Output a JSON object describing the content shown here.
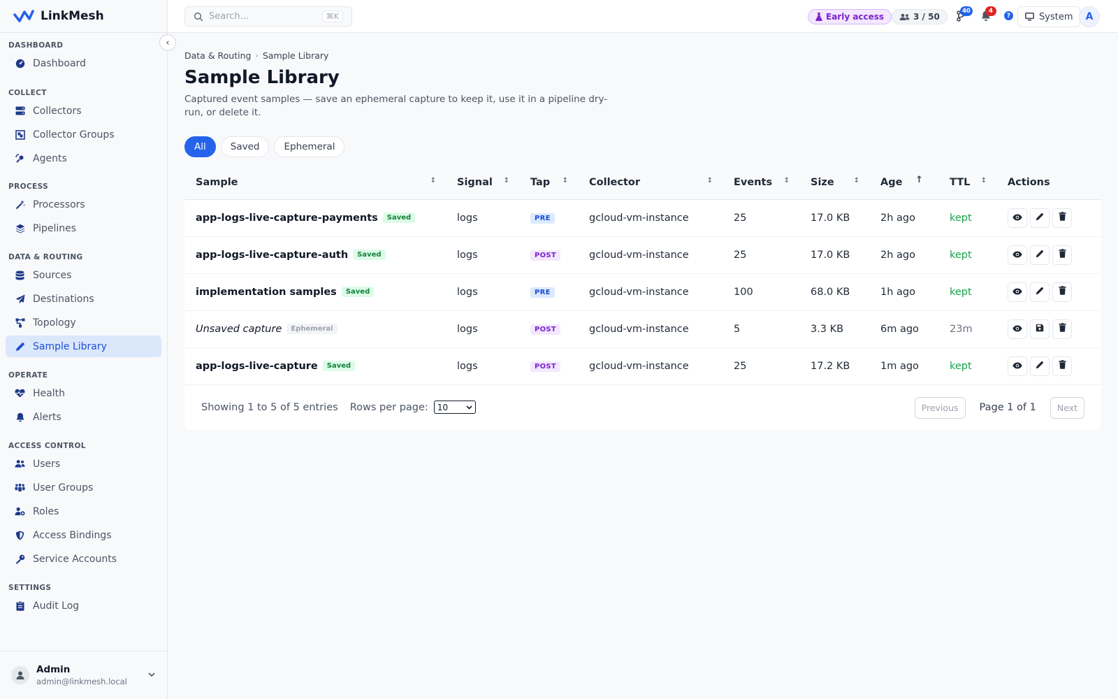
{
  "app": {
    "name": "LinkMesh"
  },
  "sidebar": {
    "sections": [
      {
        "title": "DASHBOARD",
        "items": [
          {
            "label": "Dashboard",
            "icon": "gauge-icon"
          }
        ]
      },
      {
        "title": "COLLECT",
        "items": [
          {
            "label": "Collectors",
            "icon": "server-icon"
          },
          {
            "label": "Collector Groups",
            "icon": "object-group-icon"
          },
          {
            "label": "Agents",
            "icon": "satellite-icon"
          }
        ]
      },
      {
        "title": "PROCESS",
        "items": [
          {
            "label": "Processors",
            "icon": "wand-icon"
          },
          {
            "label": "Pipelines",
            "icon": "layers-icon"
          }
        ]
      },
      {
        "title": "DATA & ROUTING",
        "items": [
          {
            "label": "Sources",
            "icon": "database-icon"
          },
          {
            "label": "Destinations",
            "icon": "paper-plane-icon"
          },
          {
            "label": "Topology",
            "icon": "topology-icon"
          },
          {
            "label": "Sample Library",
            "icon": "pen-icon",
            "active": true
          }
        ]
      },
      {
        "title": "OPERATE",
        "items": [
          {
            "label": "Health",
            "icon": "heart-pulse-icon"
          },
          {
            "label": "Alerts",
            "icon": "bell-icon"
          }
        ]
      },
      {
        "title": "ACCESS CONTROL",
        "items": [
          {
            "label": "Users",
            "icon": "users-icon"
          },
          {
            "label": "User Groups",
            "icon": "people-group-icon"
          },
          {
            "label": "Roles",
            "icon": "user-gear-icon"
          },
          {
            "label": "Access Bindings",
            "icon": "shield-icon"
          },
          {
            "label": "Service Accounts",
            "icon": "key-icon"
          }
        ]
      },
      {
        "title": "SETTINGS",
        "items": [
          {
            "label": "Audit Log",
            "icon": "clipboard-icon"
          }
        ]
      }
    ],
    "user": {
      "name": "Admin",
      "email": "admin@linkmesh.local"
    }
  },
  "topbar": {
    "search_placeholder": "Search...",
    "search_shortcut": "⌘K",
    "early_access": "Early access",
    "users_count": "3 / 50",
    "git_badge": "40",
    "notif_badge": "4",
    "help": "?",
    "system_label": "System",
    "avatar_letter": "A"
  },
  "page": {
    "breadcrumb": [
      "Data & Routing",
      "Sample Library"
    ],
    "title": "Sample Library",
    "description": "Captured event samples — save an ephemeral capture to keep it, use it in a pipeline dry-run, or delete it.",
    "filters": [
      "All",
      "Saved",
      "Ephemeral"
    ],
    "active_filter": "All"
  },
  "table": {
    "columns": [
      "Sample",
      "Signal",
      "Tap",
      "Collector",
      "Events",
      "Size",
      "Age",
      "TTL",
      "Actions"
    ],
    "rows": [
      {
        "sample": "app-logs-live-capture-payments",
        "status": "Saved",
        "signal": "logs",
        "tap": "PRE",
        "collector": "gcloud-vm-instance",
        "events": "25",
        "size": "17.0 KB",
        "age": "2h ago",
        "ttl": "kept"
      },
      {
        "sample": "app-logs-live-capture-auth",
        "status": "Saved",
        "signal": "logs",
        "tap": "POST",
        "collector": "gcloud-vm-instance",
        "events": "25",
        "size": "17.0 KB",
        "age": "2h ago",
        "ttl": "kept"
      },
      {
        "sample": "implementation samples",
        "status": "Saved",
        "signal": "logs",
        "tap": "PRE",
        "collector": "gcloud-vm-instance",
        "events": "100",
        "size": "68.0 KB",
        "age": "1h ago",
        "ttl": "kept"
      },
      {
        "sample": "Unsaved capture",
        "status": "Ephemeral",
        "signal": "logs",
        "tap": "POST",
        "collector": "gcloud-vm-instance",
        "events": "5",
        "size": "3.3 KB",
        "age": "6m ago",
        "ttl": "23m"
      },
      {
        "sample": "app-logs-live-capture",
        "status": "Saved",
        "signal": "logs",
        "tap": "POST",
        "collector": "gcloud-vm-instance",
        "events": "25",
        "size": "17.2 KB",
        "age": "1m ago",
        "ttl": "kept"
      }
    ],
    "footer": {
      "showing": "Showing 1 to 5 of 5 entries",
      "rows_label": "Rows per page:",
      "rows_value": "10",
      "previous": "Previous",
      "page_label": "Page 1 of 1",
      "next": "Next"
    }
  },
  "colors": {
    "accent": "#2563eb",
    "saved": "#15803d",
    "kept": "#16a34a"
  }
}
